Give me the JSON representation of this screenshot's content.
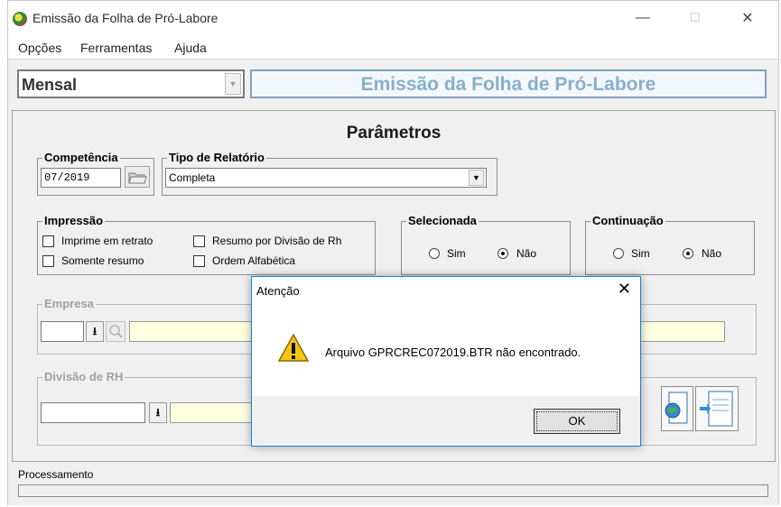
{
  "window": {
    "title": "Emissão da Folha de Pró-Labore",
    "controls": {
      "minimize": "—",
      "maximize": "☐",
      "close": "✕"
    }
  },
  "menu": [
    "Opções",
    "Ferramentas",
    "Ajuda"
  ],
  "top": {
    "period_value": "Mensal",
    "banner_title": "Emissão da Folha de Pró-Labore"
  },
  "params": {
    "title": "Parâmetros",
    "competencia": {
      "label": "Competência",
      "value": "07/2019"
    },
    "tipo_relatorio": {
      "label": "Tipo de Relatório",
      "value": "Completa"
    },
    "impressao": {
      "label": "Impressão",
      "options": [
        {
          "label": "Imprime em retrato",
          "checked": false
        },
        {
          "label": "Somente resumo",
          "checked": false
        },
        {
          "label": "Resumo por Divisão de Rh",
          "checked": false
        },
        {
          "label": "Ordem Alfabética",
          "checked": false
        }
      ]
    },
    "selecionada": {
      "label": "Selecionada",
      "sim": "Sim",
      "nao": "Não",
      "selected": "Não"
    },
    "continuacao": {
      "label": "Continuação",
      "sim": "Sim",
      "nao": "Não",
      "selected": "Não"
    },
    "empresa": {
      "label": "Empresa"
    },
    "divisao_rh": {
      "label": "Divisão de RH"
    }
  },
  "dialog": {
    "title": "Atenção",
    "message": "Arquivo GPRCREC072019.BTR não encontrado.",
    "ok_label": "OK",
    "close": "✕"
  },
  "status": {
    "label": "Processamento",
    "progress": 0
  },
  "colors": {
    "banner_text": "#8aaecb",
    "banner_bg": "#f2f8fd",
    "dialog_border": "#1883d7",
    "field_yellow": "#ffffe1"
  }
}
